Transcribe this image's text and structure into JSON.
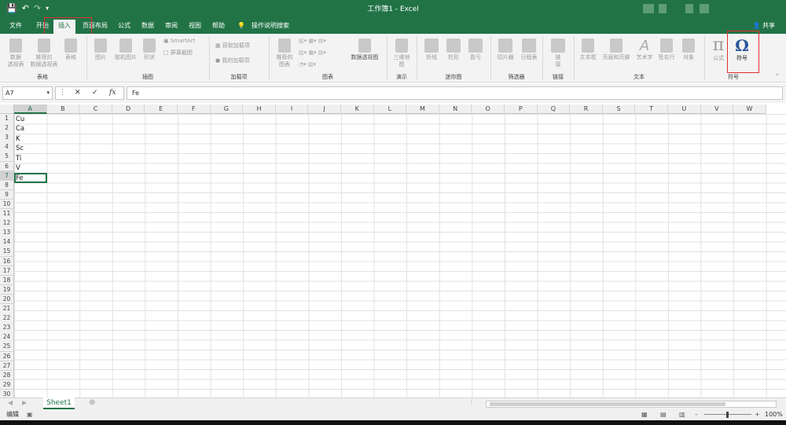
{
  "window": {
    "title": "工作簿1 - Excel"
  },
  "qat": {
    "save_icon": "save-icon",
    "undo_icon": "undo-icon",
    "redo_icon": "redo-icon",
    "customize_icon": "chevron-down-icon"
  },
  "tabs": [
    "文件",
    "开始",
    "插入",
    "页面布局",
    "公式",
    "数据",
    "审阅",
    "视图",
    "帮助"
  ],
  "tell_me": "操作说明搜索",
  "share": "共享",
  "ribbon": {
    "tables": {
      "label": "表格",
      "pivot": "数据\n透视表",
      "recommended_pivot": "推荐的\n数据透视表",
      "table": "表格"
    },
    "illustrations": {
      "label": "插图",
      "pictures": "图片",
      "online_pictures": "联机图片",
      "shapes": "形状",
      "smartart": "SmartArt",
      "screenshot": "屏幕截图"
    },
    "addins": {
      "label": "加载项",
      "get_addins": "获取加载项",
      "my_addins": "我的加载项"
    },
    "charts": {
      "label": "图表",
      "recommended": "推荐的\n图表",
      "pivotchart": "数据透视图"
    },
    "tours": {
      "label": "演示",
      "map3d": "三维地\n图"
    },
    "sparklines": {
      "label": "迷你图",
      "line": "折线",
      "column": "柱形",
      "winloss": "盈亏"
    },
    "filters": {
      "label": "筛选器",
      "slicer": "切片器",
      "timeline": "日程表"
    },
    "links": {
      "label": "链接",
      "link": "链\n接"
    },
    "text": {
      "label": "文本",
      "textbox": "文本框",
      "header_footer": "页眉和页脚",
      "wordart": "艺术字",
      "signature": "签名行",
      "object": "对象"
    },
    "symbols": {
      "label": "符号",
      "equation": "公式",
      "symbol": "符号",
      "omega_glyph": "Ω",
      "pi_glyph": "π"
    }
  },
  "formula_bar": {
    "name_box": "A7",
    "cancel_glyph": "✕",
    "enter_glyph": "✓",
    "fx_glyph": "fx",
    "value": "Fe"
  },
  "columns": [
    "A",
    "B",
    "C",
    "D",
    "E",
    "F",
    "G",
    "H",
    "I",
    "J",
    "K",
    "L",
    "M",
    "N",
    "O",
    "P",
    "Q",
    "R",
    "S",
    "T",
    "U",
    "V",
    "W"
  ],
  "rows": [
    "1",
    "2",
    "3",
    "4",
    "5",
    "6",
    "7",
    "8",
    "9",
    "10",
    "11",
    "12",
    "13",
    "14",
    "15",
    "16",
    "17",
    "18",
    "19",
    "20",
    "21",
    "22",
    "23",
    "24",
    "25",
    "26",
    "27",
    "28",
    "29",
    "30"
  ],
  "cells": {
    "A1": "Cu",
    "A2": "Ca",
    "A3": "K",
    "A4": "Sc",
    "A5": "Ti",
    "A6": "V",
    "A7": "Fe"
  },
  "sheets": [
    "Sheet1"
  ],
  "status": {
    "mode": "编辑",
    "zoom": "100%"
  },
  "colors": {
    "accent": "#217346",
    "highlight": "#e03030"
  }
}
